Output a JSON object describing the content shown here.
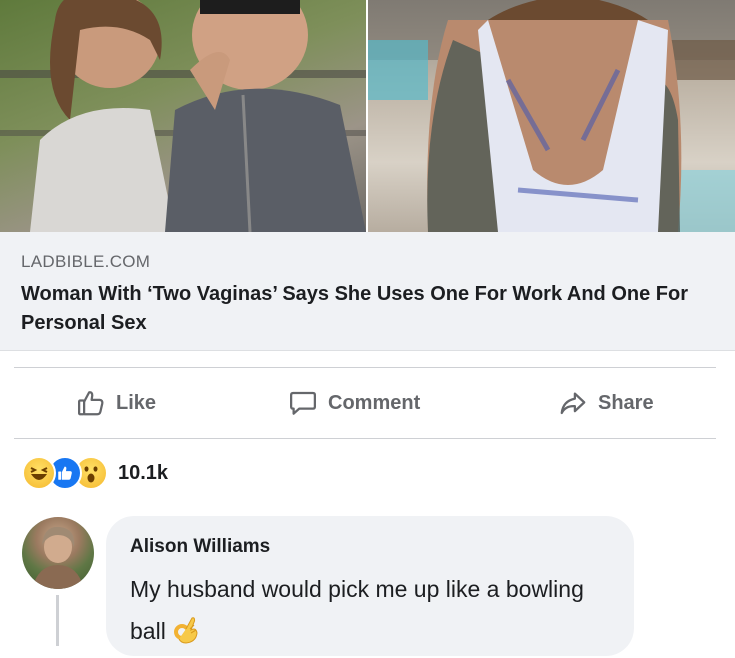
{
  "link_preview": {
    "domain": "LADBIBLE.COM",
    "headline": "Woman With ‘Two Vaginas’ Says She Uses One For Work And One For Personal Sex"
  },
  "actions": {
    "like_label": "Like",
    "comment_label": "Comment",
    "share_label": "Share"
  },
  "reactions": {
    "icons": [
      "haha-reaction-icon",
      "like-reaction-icon",
      "wow-reaction-icon"
    ],
    "count": "10.1k"
  },
  "comment": {
    "author": "Alison Williams",
    "text": "My husband would pick me up like a bowling ball",
    "emoji": "ok-hand-emoji"
  },
  "colors": {
    "accent": "#1877f2",
    "secondary_text": "#65676b",
    "bubble": "#f0f2f5"
  }
}
